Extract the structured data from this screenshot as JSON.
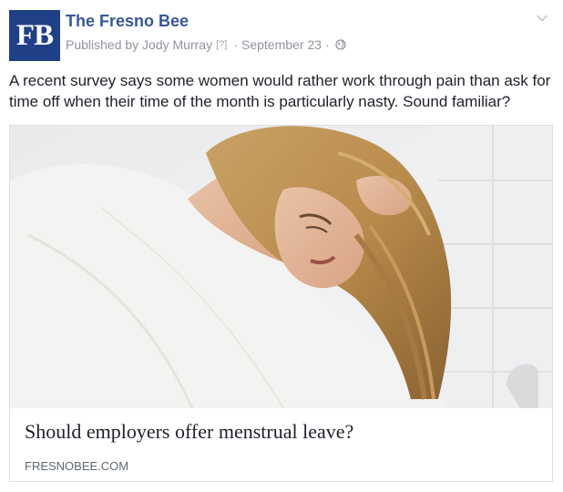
{
  "post": {
    "page_name": "The Fresno Bee",
    "avatar_text": "FB",
    "byline": "Published by Jody Murray",
    "byline_help": "[?]",
    "separator": "·",
    "date": "September 23",
    "privacy_icon": "globe-icon",
    "menu_icon": "chevron-down-icon",
    "text": "A recent survey says some women would rather work through pain than ask for time off when their time of the month is particularly nasty. Sound familiar?"
  },
  "link": {
    "image_icon": "article-photo",
    "title": "Should employers offer menstrual leave?",
    "domain": "FRESNOBEE.COM"
  },
  "colors": {
    "brand": "#1f3f87",
    "link_blue": "#365899",
    "meta_gray": "#90949c"
  }
}
